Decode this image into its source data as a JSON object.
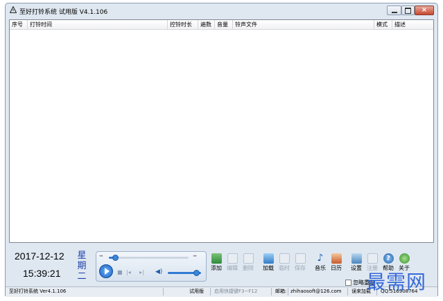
{
  "window": {
    "title": "至好打铃系统 试用版 V4.1.106"
  },
  "list": {
    "columns": [
      "序号",
      "打铃时间",
      "控铃时长",
      "遍数",
      "音量",
      "铃声文件",
      "模式",
      "描述"
    ]
  },
  "clock": {
    "date": "2017-12-12",
    "time": "15:39:21",
    "weekday": "星期二"
  },
  "player": {
    "progress": 0.08,
    "volume": 0.85
  },
  "toolbar": {
    "add": "添加",
    "edit": "编辑",
    "delete": "删除",
    "load": "加载",
    "temp": "临时",
    "save": "保存",
    "music": "音乐",
    "calendar": "日历",
    "settings": "设置",
    "register": "注册",
    "help": "帮助",
    "close": "关于"
  },
  "status": {
    "app": "至好打铃系统 Ver4.1.106",
    "mode": "试用版",
    "hint": "启用快捷键F3~F12",
    "mail_label": "邮箱:",
    "mail": "zhihaosoft@126.com",
    "contact": "误来加载",
    "qq": "QQ:516908764"
  },
  "checkbox": {
    "label": "忽略重复"
  },
  "watermark": {
    "text": "最需网"
  },
  "colors": {
    "accent": "#1f57d6",
    "weekday": "#1b3fa8"
  }
}
